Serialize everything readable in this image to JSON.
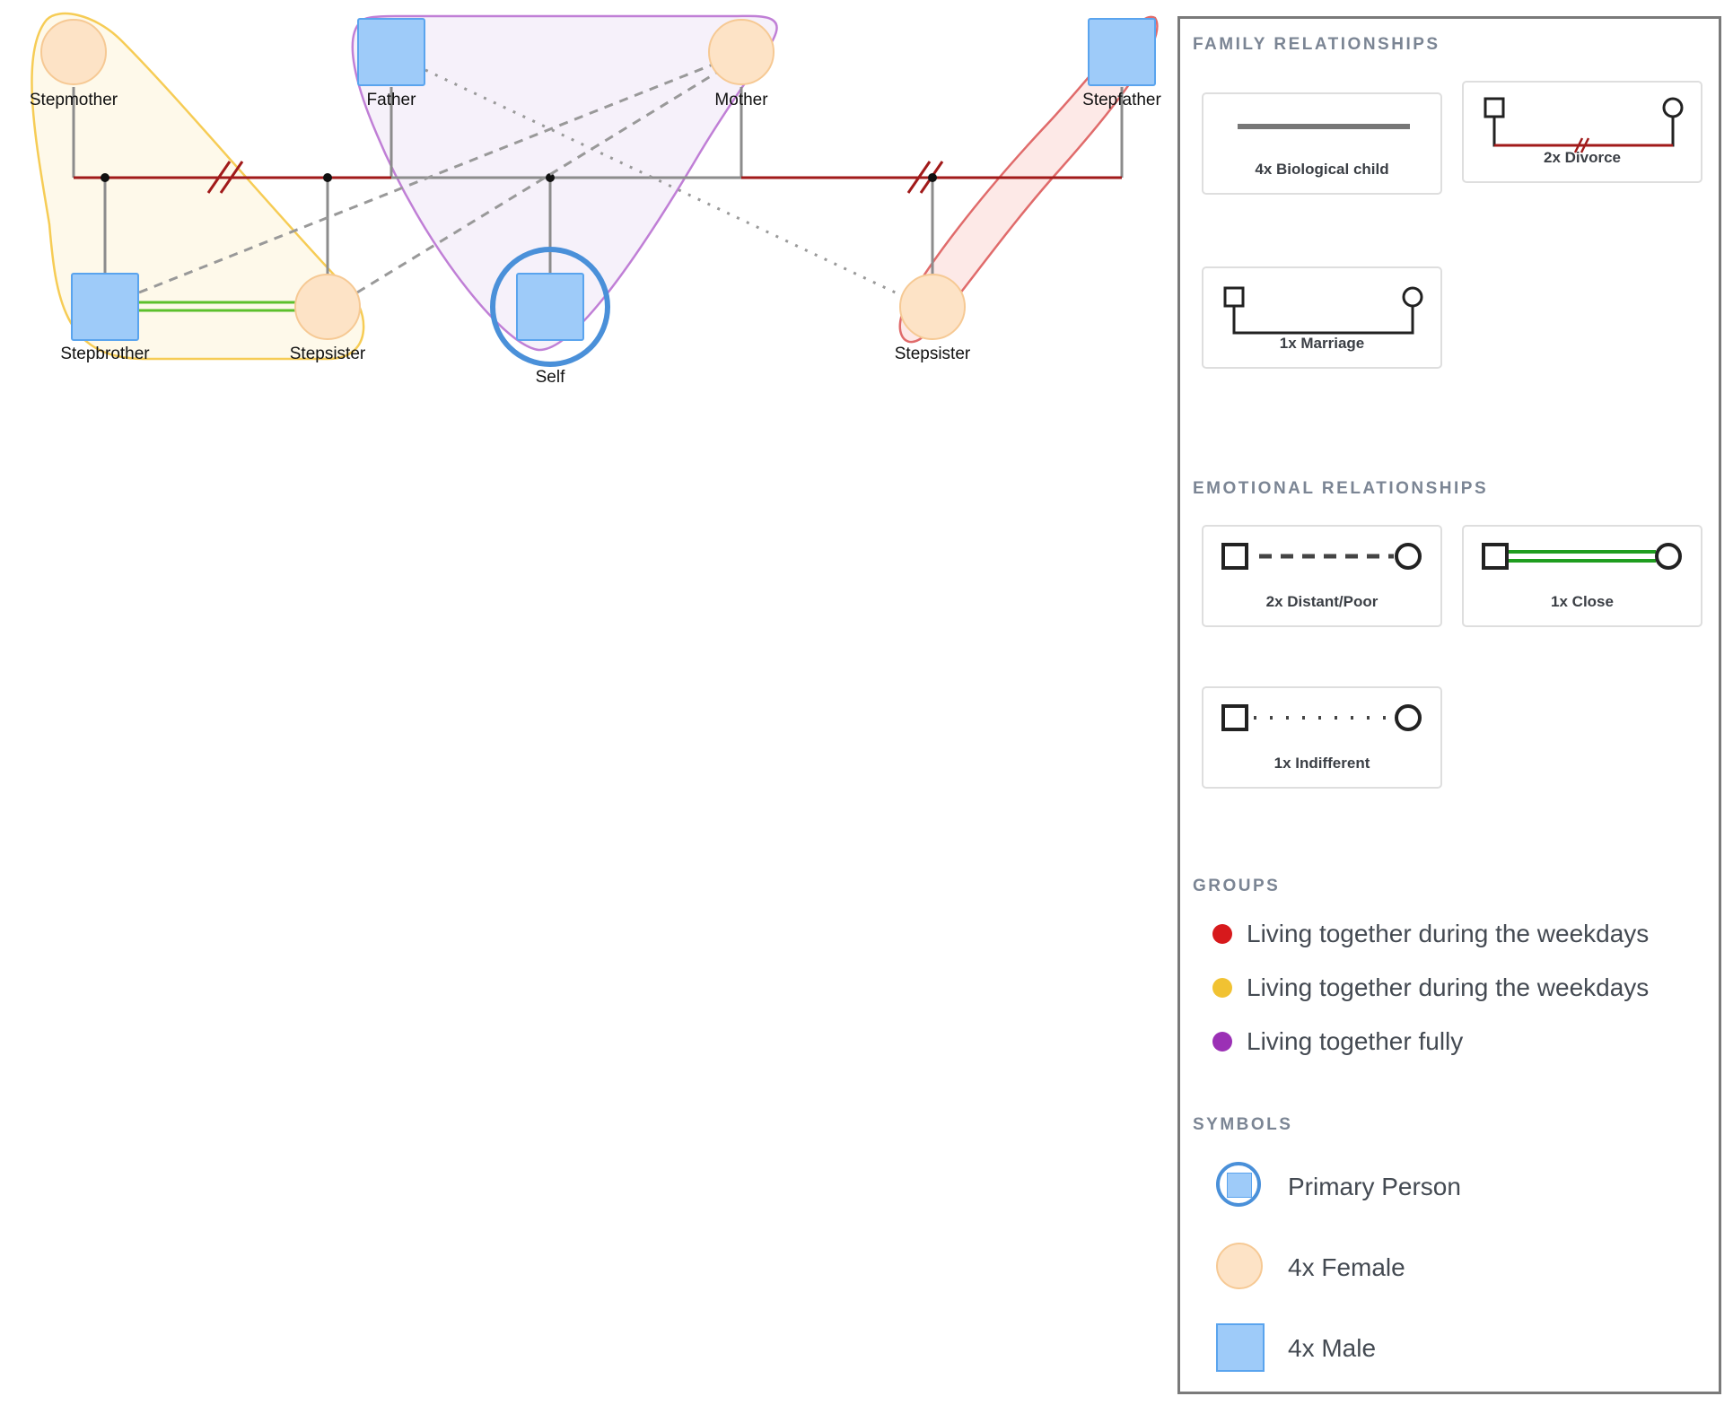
{
  "people": [
    {
      "id": "stepmother",
      "name": "Stepmother",
      "sex": "female"
    },
    {
      "id": "father",
      "name": "Father",
      "sex": "male"
    },
    {
      "id": "mother",
      "name": "Mother",
      "sex": "female"
    },
    {
      "id": "stepfather",
      "name": "Stepfather",
      "sex": "male"
    },
    {
      "id": "stepbrother",
      "name": "Stepbrother",
      "sex": "male"
    },
    {
      "id": "stepsister1",
      "name": "Stepsister",
      "sex": "female"
    },
    {
      "id": "self",
      "name": "Self",
      "sex": "male",
      "primary": true
    },
    {
      "id": "stepsister2",
      "name": "Stepsister",
      "sex": "female"
    }
  ],
  "colors": {
    "male_fill": "#9ecbf9",
    "male_stroke": "#5aa4ee",
    "female_fill": "#fde3c6",
    "female_stroke": "#f6c994",
    "primary_ring": "#4a90d9",
    "divorce": "#a11a1a",
    "child_line": "#8c8c8c",
    "close": "#5cc02c",
    "distant": "#999999",
    "indifferent": "#999999"
  },
  "legend": {
    "family": {
      "title": "FAMILY RELATIONSHIPS",
      "items": [
        {
          "type": "biological-child",
          "label": "4x Biological child"
        },
        {
          "type": "divorce",
          "label": "2x Divorce"
        },
        {
          "type": "marriage",
          "label": "1x Marriage"
        }
      ]
    },
    "emotional": {
      "title": "EMOTIONAL RELATIONSHIPS",
      "items": [
        {
          "type": "distant",
          "label": "2x Distant/Poor"
        },
        {
          "type": "close",
          "label": "1x Close"
        },
        {
          "type": "indifferent",
          "label": "1x Indifferent"
        }
      ]
    },
    "groups": {
      "title": "GROUPS",
      "items": [
        {
          "label": "Living together during the weekdays",
          "color": "#d7191c"
        },
        {
          "label": "Living together during the weekdays",
          "color": "#f1c232"
        },
        {
          "label": "Living together fully",
          "color": "#9b30b5"
        }
      ]
    },
    "symbols": {
      "title": "SYMBOLS",
      "items": [
        {
          "type": "primary",
          "label": "Primary Person"
        },
        {
          "type": "female",
          "label": "4x Female"
        },
        {
          "type": "male",
          "label": "4x Male"
        }
      ]
    }
  }
}
